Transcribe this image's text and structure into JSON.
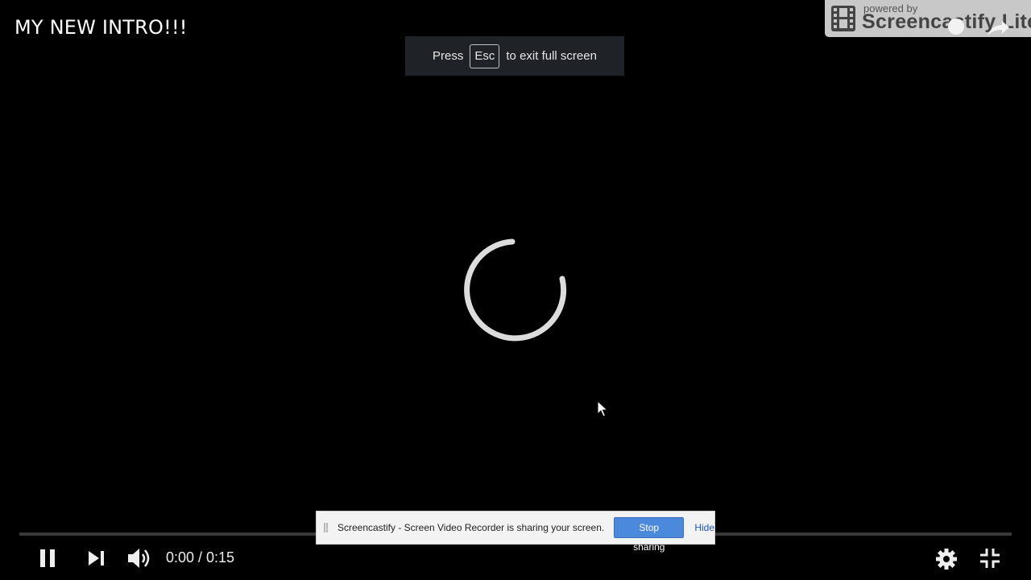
{
  "video": {
    "title": "MY NEW INTRO!!!"
  },
  "fullscreen_toast": {
    "prefix": "Press",
    "key": "Esc",
    "suffix": "to exit full screen"
  },
  "watermark": {
    "powered_by": "powered by",
    "brand": "Screencastify Lite"
  },
  "player": {
    "state": "loading",
    "progress_fraction": 0.0,
    "current_time": "0:00",
    "duration": "0:15",
    "time_display": "0:00 / 0:15",
    "icons": {
      "play_pause": "pause-icon",
      "next": "next-icon",
      "volume": "volume-icon",
      "settings": "gear-icon",
      "fullscreen": "exit-fullscreen-icon",
      "spinner": "loading-spinner-icon"
    }
  },
  "share_bar": {
    "message": "Screencastify - Screen Video Recorder is sharing your screen.",
    "stop_label": "Stop sharing",
    "hide_label": "Hide"
  },
  "colors": {
    "background": "#000000",
    "progress_played": "#ff0000",
    "stop_button": "#4b89dc",
    "hide_link": "#1a56c4"
  }
}
